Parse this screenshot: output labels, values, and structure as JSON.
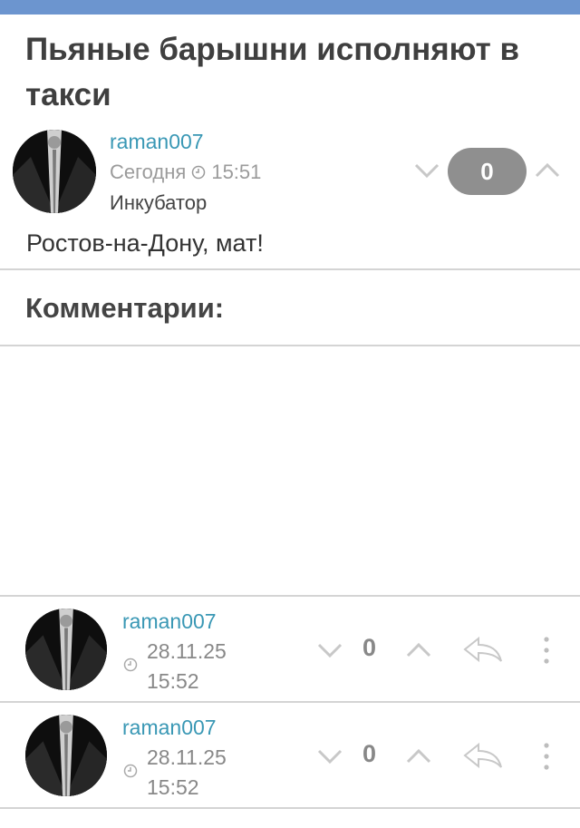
{
  "post": {
    "title": "Пьяные барышни исполняют в такси",
    "author": "raman007",
    "date_label": "Сегодня",
    "time": "15:51",
    "category": "Инкубатор",
    "score": "0",
    "text": "Ростов-на-Дону, мат!"
  },
  "comments_heading": "Комментарии:",
  "comments": [
    {
      "author": "raman007",
      "date": "28.11.25",
      "time": "15:52",
      "score": "0"
    },
    {
      "author": "raman007",
      "date": "28.11.25",
      "time": "15:52",
      "score": "0"
    }
  ],
  "colors": {
    "topbar": "#6c95cf",
    "link": "#3a98b5",
    "score_pill": "#8f8f8f"
  },
  "icons": [
    "clock-icon",
    "chevron-down-icon",
    "chevron-up-icon",
    "reply-icon",
    "more-vert-icon"
  ]
}
